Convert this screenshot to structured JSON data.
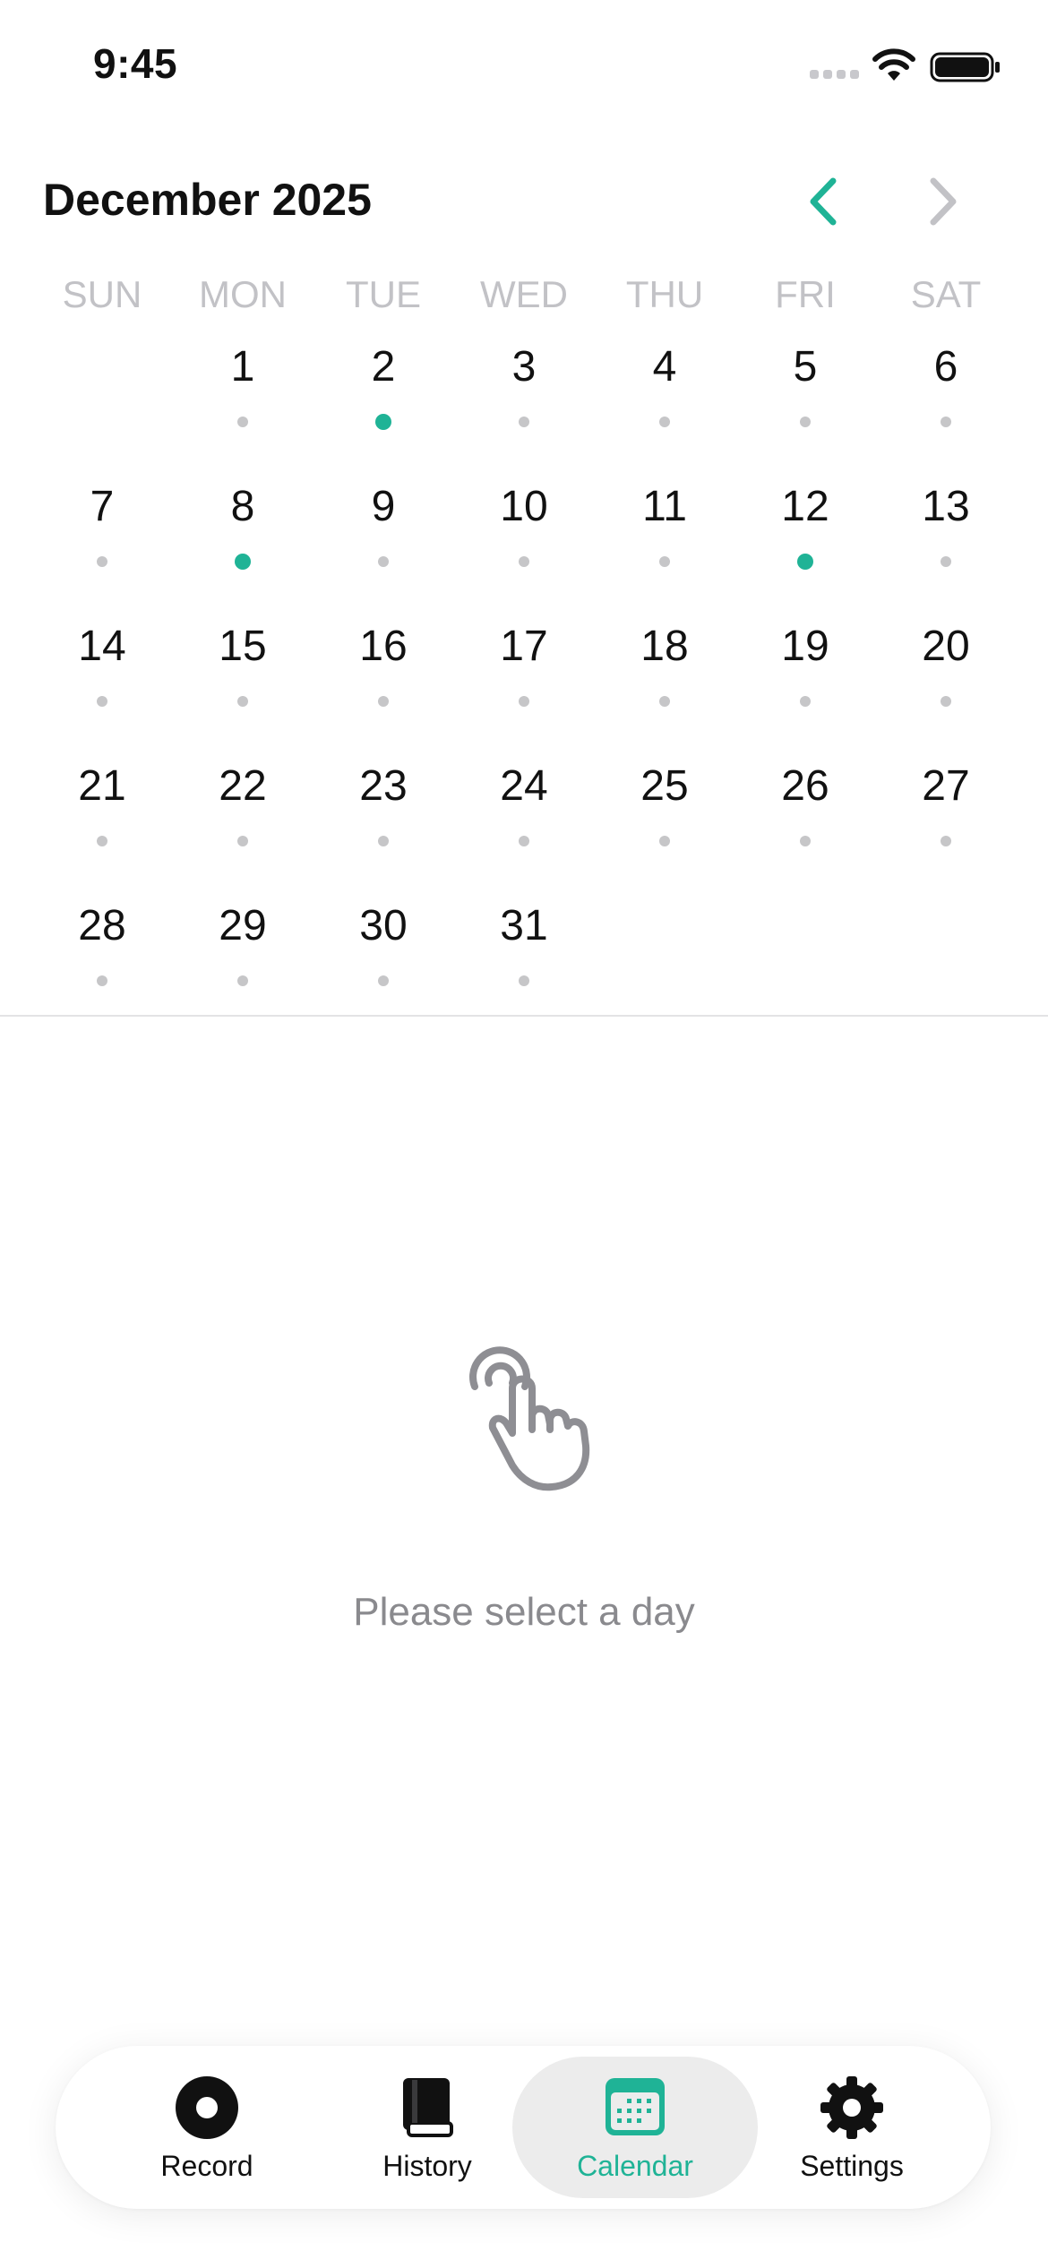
{
  "status_bar": {
    "time": "9:45"
  },
  "calendar": {
    "month_title": "December 2025",
    "weekdays": [
      "SUN",
      "MON",
      "TUE",
      "WED",
      "THU",
      "FRI",
      "SAT"
    ],
    "first_weekday_index": 1,
    "days": [
      {
        "day": "1",
        "has_entry": false
      },
      {
        "day": "2",
        "has_entry": true
      },
      {
        "day": "3",
        "has_entry": false
      },
      {
        "day": "4",
        "has_entry": false
      },
      {
        "day": "5",
        "has_entry": false
      },
      {
        "day": "6",
        "has_entry": false
      },
      {
        "day": "7",
        "has_entry": false
      },
      {
        "day": "8",
        "has_entry": true
      },
      {
        "day": "9",
        "has_entry": false
      },
      {
        "day": "10",
        "has_entry": false
      },
      {
        "day": "11",
        "has_entry": false
      },
      {
        "day": "12",
        "has_entry": true
      },
      {
        "day": "13",
        "has_entry": false
      },
      {
        "day": "14",
        "has_entry": false
      },
      {
        "day": "15",
        "has_entry": false
      },
      {
        "day": "16",
        "has_entry": false
      },
      {
        "day": "17",
        "has_entry": false
      },
      {
        "day": "18",
        "has_entry": false
      },
      {
        "day": "19",
        "has_entry": false
      },
      {
        "day": "20",
        "has_entry": false
      },
      {
        "day": "21",
        "has_entry": false
      },
      {
        "day": "22",
        "has_entry": false
      },
      {
        "day": "23",
        "has_entry": false
      },
      {
        "day": "24",
        "has_entry": false
      },
      {
        "day": "25",
        "has_entry": false
      },
      {
        "day": "26",
        "has_entry": false
      },
      {
        "day": "27",
        "has_entry": false
      },
      {
        "day": "28",
        "has_entry": false
      },
      {
        "day": "29",
        "has_entry": false
      },
      {
        "day": "30",
        "has_entry": false
      },
      {
        "day": "31",
        "has_entry": false
      }
    ]
  },
  "empty_state": {
    "icon": "hand-tap-icon",
    "message": "Please select a day"
  },
  "tab_bar": {
    "tabs": [
      {
        "label": "Record",
        "icon": "record-icon",
        "active": false
      },
      {
        "label": "History",
        "icon": "book-icon",
        "active": false
      },
      {
        "label": "Calendar",
        "icon": "calendar-icon",
        "active": true
      },
      {
        "label": "Settings",
        "icon": "gear-icon",
        "active": false
      }
    ]
  },
  "colors": {
    "accent": "#1fb396",
    "muted": "#c6c6c8",
    "text": "#111111",
    "secondary_text": "#8a8a8e"
  }
}
